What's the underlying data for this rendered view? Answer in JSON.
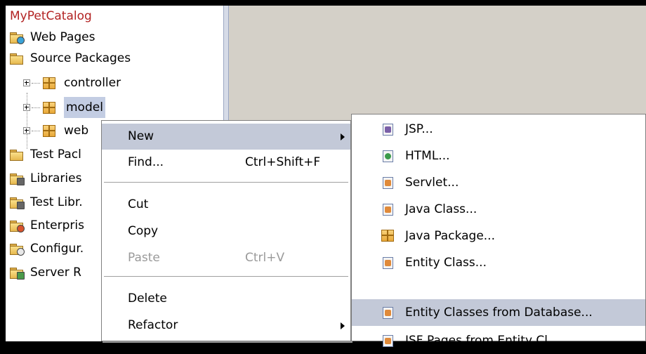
{
  "tree": {
    "root": "MyPetCatalog",
    "items": [
      {
        "label": "Web Pages",
        "icon": "web-pages-folder-icon"
      },
      {
        "label": "Source Packages",
        "icon": "source-packages-folder-icon"
      },
      {
        "label": "controller",
        "icon": "package-icon"
      },
      {
        "label": "model",
        "icon": "package-icon"
      },
      {
        "label": "web",
        "icon": "package-icon"
      },
      {
        "label": "Test Pacl",
        "icon": "test-packages-folder-icon"
      },
      {
        "label": "Libraries",
        "icon": "libraries-folder-icon"
      },
      {
        "label": "Test Libr.",
        "icon": "test-libraries-folder-icon"
      },
      {
        "label": "Enterpris",
        "icon": "enterprise-folder-icon"
      },
      {
        "label": "Configur.",
        "icon": "configuration-folder-icon"
      },
      {
        "label": "Server R",
        "icon": "server-resources-folder-icon"
      }
    ]
  },
  "context_menu": {
    "items": [
      {
        "label": "New",
        "accel": "",
        "submenu": true,
        "highlighted": true
      },
      {
        "label": "Find...",
        "accel": "Ctrl+Shift+F"
      },
      {
        "label": "Cut",
        "accel": ""
      },
      {
        "label": "Copy",
        "accel": ""
      },
      {
        "label": "Paste",
        "accel": "Ctrl+V",
        "disabled": true
      },
      {
        "label": "Delete",
        "accel": ""
      },
      {
        "label": "Refactor",
        "accel": "",
        "submenu": true
      }
    ]
  },
  "new_submenu": {
    "items": [
      {
        "label": "JSP...",
        "icon": "jsp-file-icon"
      },
      {
        "label": "HTML...",
        "icon": "html-file-icon"
      },
      {
        "label": "Servlet...",
        "icon": "servlet-file-icon"
      },
      {
        "label": "Java Class...",
        "icon": "java-class-file-icon"
      },
      {
        "label": "Java Package...",
        "icon": "java-package-icon"
      },
      {
        "label": "Entity Class...",
        "icon": "entity-class-file-icon"
      },
      {
        "label": "Entity Classes from Database...",
        "icon": "entity-classes-db-file-icon",
        "highlighted": true
      },
      {
        "label": "JSF Pages from Entity Cl...",
        "icon": "jsf-pages-file-icon"
      }
    ]
  },
  "colors": {
    "root_label": "#b22222",
    "highlight": "#c3c9d8",
    "editor_bg": "#d4d0c8",
    "disabled_text": "#9a9a9a"
  }
}
